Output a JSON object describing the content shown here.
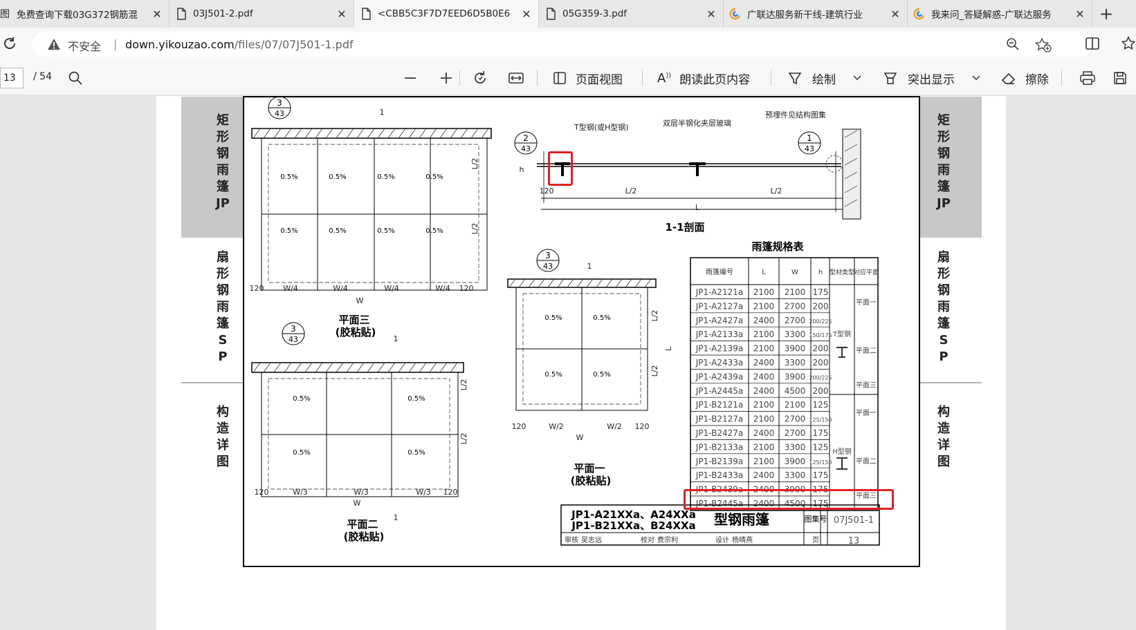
{
  "tabs": [
    {
      "label": "免费查询下载03G372钢筋混",
      "icon": "image-icon",
      "prefix": "图"
    },
    {
      "label": "03J501-2.pdf",
      "icon": "pdf-file-icon"
    },
    {
      "label": "<CBB5C3F7D7EED6D5B0E6",
      "icon": "pdf-file-icon"
    },
    {
      "label": "05G359-3.pdf",
      "icon": "pdf-file-icon"
    },
    {
      "label": "广联达服务新干线-建筑行业",
      "icon": "glodon-logo-icon"
    },
    {
      "label": "我来问_答疑解惑-广联达服务",
      "icon": "glodon-logo-icon"
    }
  ],
  "address": {
    "insecure_label": "不安全",
    "host": "down.yikouzao.com",
    "path": "/files/07/07J501-1.pdf"
  },
  "pdf_toolbar": {
    "page_current": "13",
    "page_total": "/ 54",
    "page_view": "页面视图",
    "read_aloud": "朗读此页内容",
    "draw": "绘制",
    "highlight": "突出显示",
    "erase": "擦除"
  },
  "drawing": {
    "side_left": {
      "top": "矩形钢雨篷JP",
      "mid": "扇形钢雨篷SP",
      "bottom": "构造详图"
    },
    "side_right": {
      "top": "矩形钢雨篷JP",
      "mid": "扇形钢雨篷SP",
      "bottom": "构造详图"
    },
    "callout_num": "3",
    "callout_den": "43",
    "callout2_num": "2",
    "callout2_den": "43",
    "callout1_num": "1",
    "callout1_den": "43",
    "slope": "0.5%",
    "plan3_title": "平面三",
    "plan3_sub": "(胶粘贴)",
    "plan2_title": "平面二",
    "plan2_sub": "(胶粘贴)",
    "plan1_title": "平面一",
    "plan1_sub": "(胶粘贴)",
    "section_title": "1-1剖面",
    "t_steel_label": "T型钢(或H型钢)",
    "glass_label": "双层半钢化夹层玻璃",
    "embed_label": "预埋件见结构图集",
    "dim_w4": "W/4",
    "dim_w3": "W/3",
    "dim_w2": "W/2",
    "dim_w": "W",
    "dim_l2": "L/2",
    "dim_l": "L",
    "dim_120": "120",
    "dim_h": "h",
    "dim_1": "1",
    "table_title": "雨篷规格表",
    "table_headers": [
      "雨篷编号",
      "L",
      "W",
      "h",
      "型材类型",
      "对应平面"
    ],
    "table_rows": [
      [
        "JP1-A2121a",
        "2100",
        "2100",
        "175"
      ],
      [
        "JP1-A2127a",
        "2100",
        "2700",
        "200"
      ],
      [
        "JP1-A2427a",
        "2400",
        "2700",
        "200/225"
      ],
      [
        "JP1-A2133a",
        "2100",
        "3300",
        "150/175"
      ],
      [
        "JP1-A2139a",
        "2100",
        "3900",
        "200"
      ],
      [
        "JP1-A2433a",
        "2400",
        "3300",
        "200"
      ],
      [
        "JP1-A2439a",
        "2400",
        "3900",
        "200/225"
      ],
      [
        "JP1-A2445a",
        "2400",
        "4500",
        "200"
      ],
      [
        "JP1-B2121a",
        "2100",
        "2100",
        "125"
      ],
      [
        "JP1-B2127a",
        "2100",
        "2700",
        "125/150"
      ],
      [
        "JP1-B2427a",
        "2400",
        "2700",
        "175"
      ],
      [
        "JP1-B2133a",
        "2100",
        "3300",
        "125"
      ],
      [
        "JP1-B2139a",
        "2100",
        "3900",
        "125/150"
      ],
      [
        "JP1-B2433a",
        "2400",
        "3300",
        "175"
      ],
      [
        "JP1-B2439a",
        "2400",
        "3900",
        "175"
      ],
      [
        "JP1-B2445a",
        "2400",
        "4500",
        "175"
      ]
    ],
    "type_t": "T型钢",
    "type_h": "H型钢",
    "plane_1": "平面一",
    "plane_2": "平面二",
    "plane_3": "平面三",
    "title_line1": "JP1-A21XXa、A24XXa",
    "title_line2": "JP1-B21XXa、B24XXa",
    "title_main": "型钢雨篷",
    "atlas_label": "图集号",
    "atlas_no": "07J501-1",
    "review_row": [
      "审核",
      "吴志远",
      "校对",
      "费宗利",
      "设计",
      "杨晴燕",
      "页"
    ],
    "page_no": "13"
  }
}
